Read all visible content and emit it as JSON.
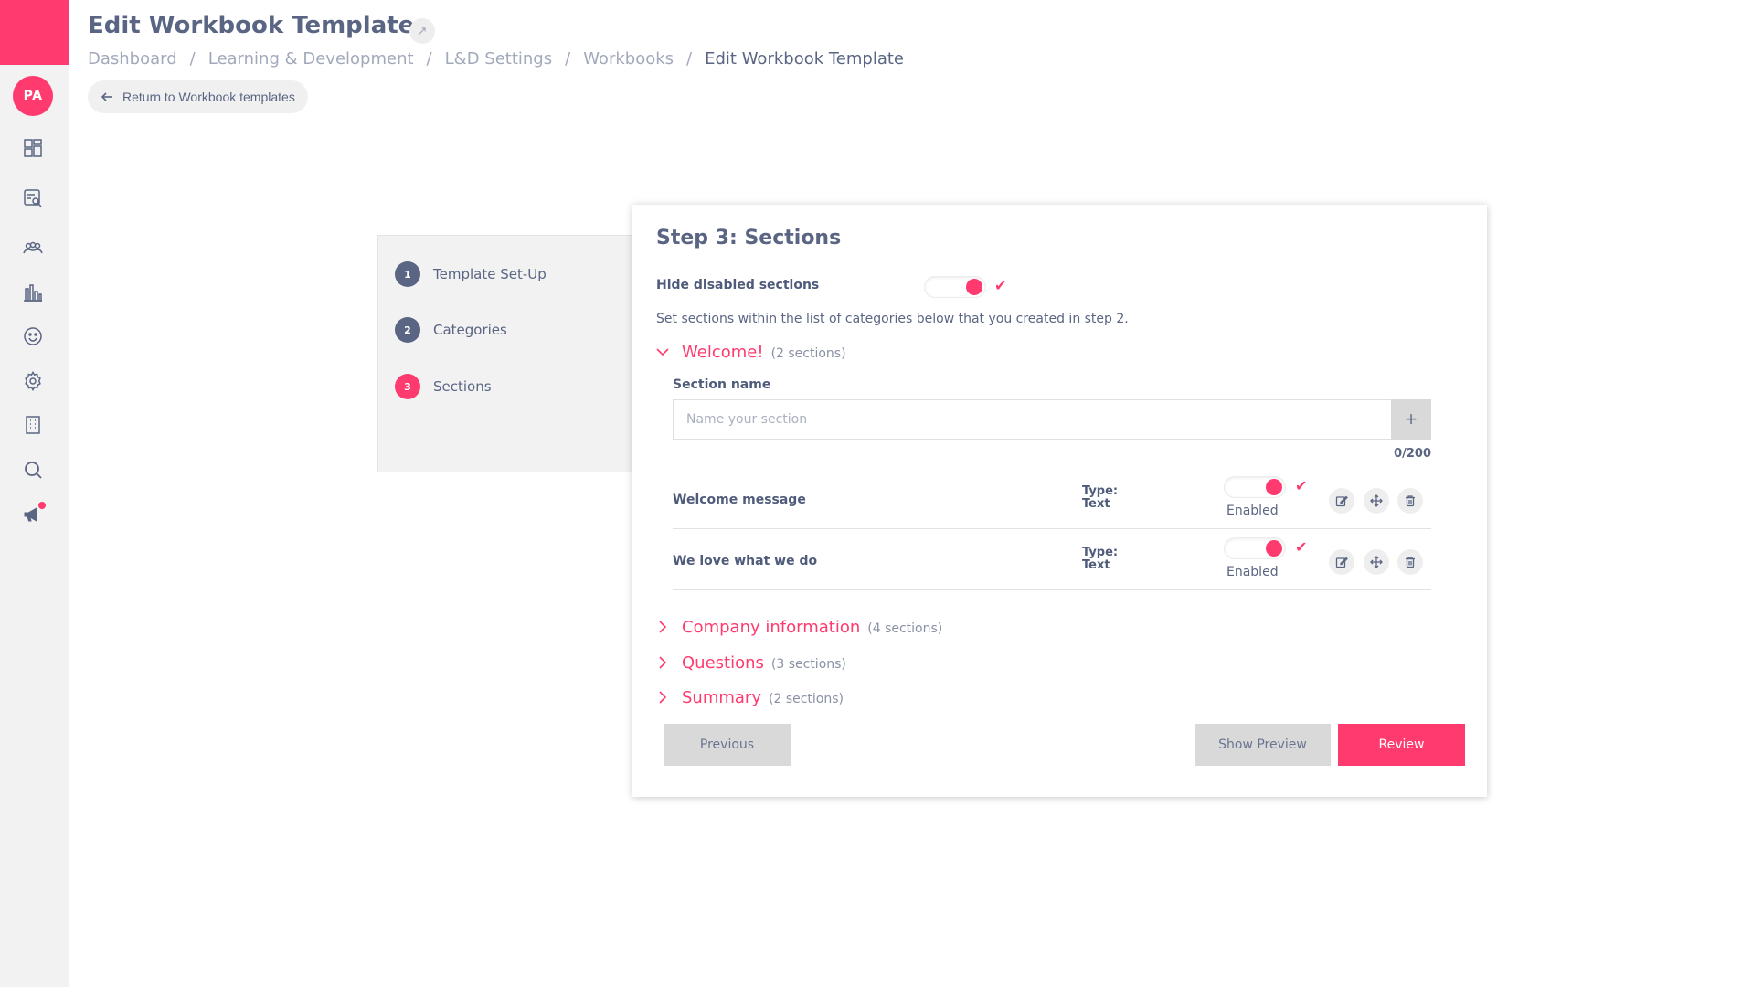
{
  "user": {
    "initials": "PA"
  },
  "header": {
    "title": "Edit Workbook Template",
    "expand_icon": "↗",
    "return_label": "Return to Workbook templates"
  },
  "breadcrumb": [
    "Dashboard",
    "Learning & Development",
    "L&D Settings",
    "Workbooks",
    "Edit Workbook Template"
  ],
  "steps": [
    {
      "num": "1",
      "label": "Template Set-Up"
    },
    {
      "num": "2",
      "label": "Categories"
    },
    {
      "num": "3",
      "label": "Sections"
    }
  ],
  "card": {
    "title": "Step 3: Sections",
    "hide_disabled_label": "Hide disabled sections",
    "hide_disabled_on": true,
    "description": "Set sections within the list of categories below that you created in step 2.",
    "section_name_label": "Section name",
    "section_name_placeholder": "Name your section",
    "section_name_value": "",
    "add_icon": "+",
    "counter": "0/200"
  },
  "categories": [
    {
      "name": "Welcome!",
      "count": "(2 sections)",
      "expanded": true
    },
    {
      "name": "Company information",
      "count": "(4 sections)",
      "expanded": false
    },
    {
      "name": "Questions",
      "count": "(3 sections)",
      "expanded": false
    },
    {
      "name": "Summary",
      "count": "(2 sections)",
      "expanded": false
    }
  ],
  "sections": [
    {
      "name": "Welcome message",
      "type_label": "Type:",
      "type_value": "Text",
      "status": "Enabled",
      "enabled": true
    },
    {
      "name": "We love what we do",
      "type_label": "Type:",
      "type_value": "Text",
      "status": "Enabled",
      "enabled": true
    }
  ],
  "buttons": {
    "previous": "Previous",
    "show_preview": "Show Preview",
    "review": "Review"
  },
  "colors": {
    "accent": "#ff3a6e",
    "text": "#5a6583",
    "sidebar_bg": "#f2f2f2"
  },
  "icons": {
    "sidebar": [
      "dashboard-icon",
      "search-document-icon",
      "team-icon",
      "bar-chart-icon",
      "smiley-icon",
      "gear-icon",
      "building-icon",
      "search-icon",
      "megaphone-icon"
    ],
    "row_actions": [
      "edit-icon",
      "move-icon",
      "trash-icon"
    ]
  }
}
